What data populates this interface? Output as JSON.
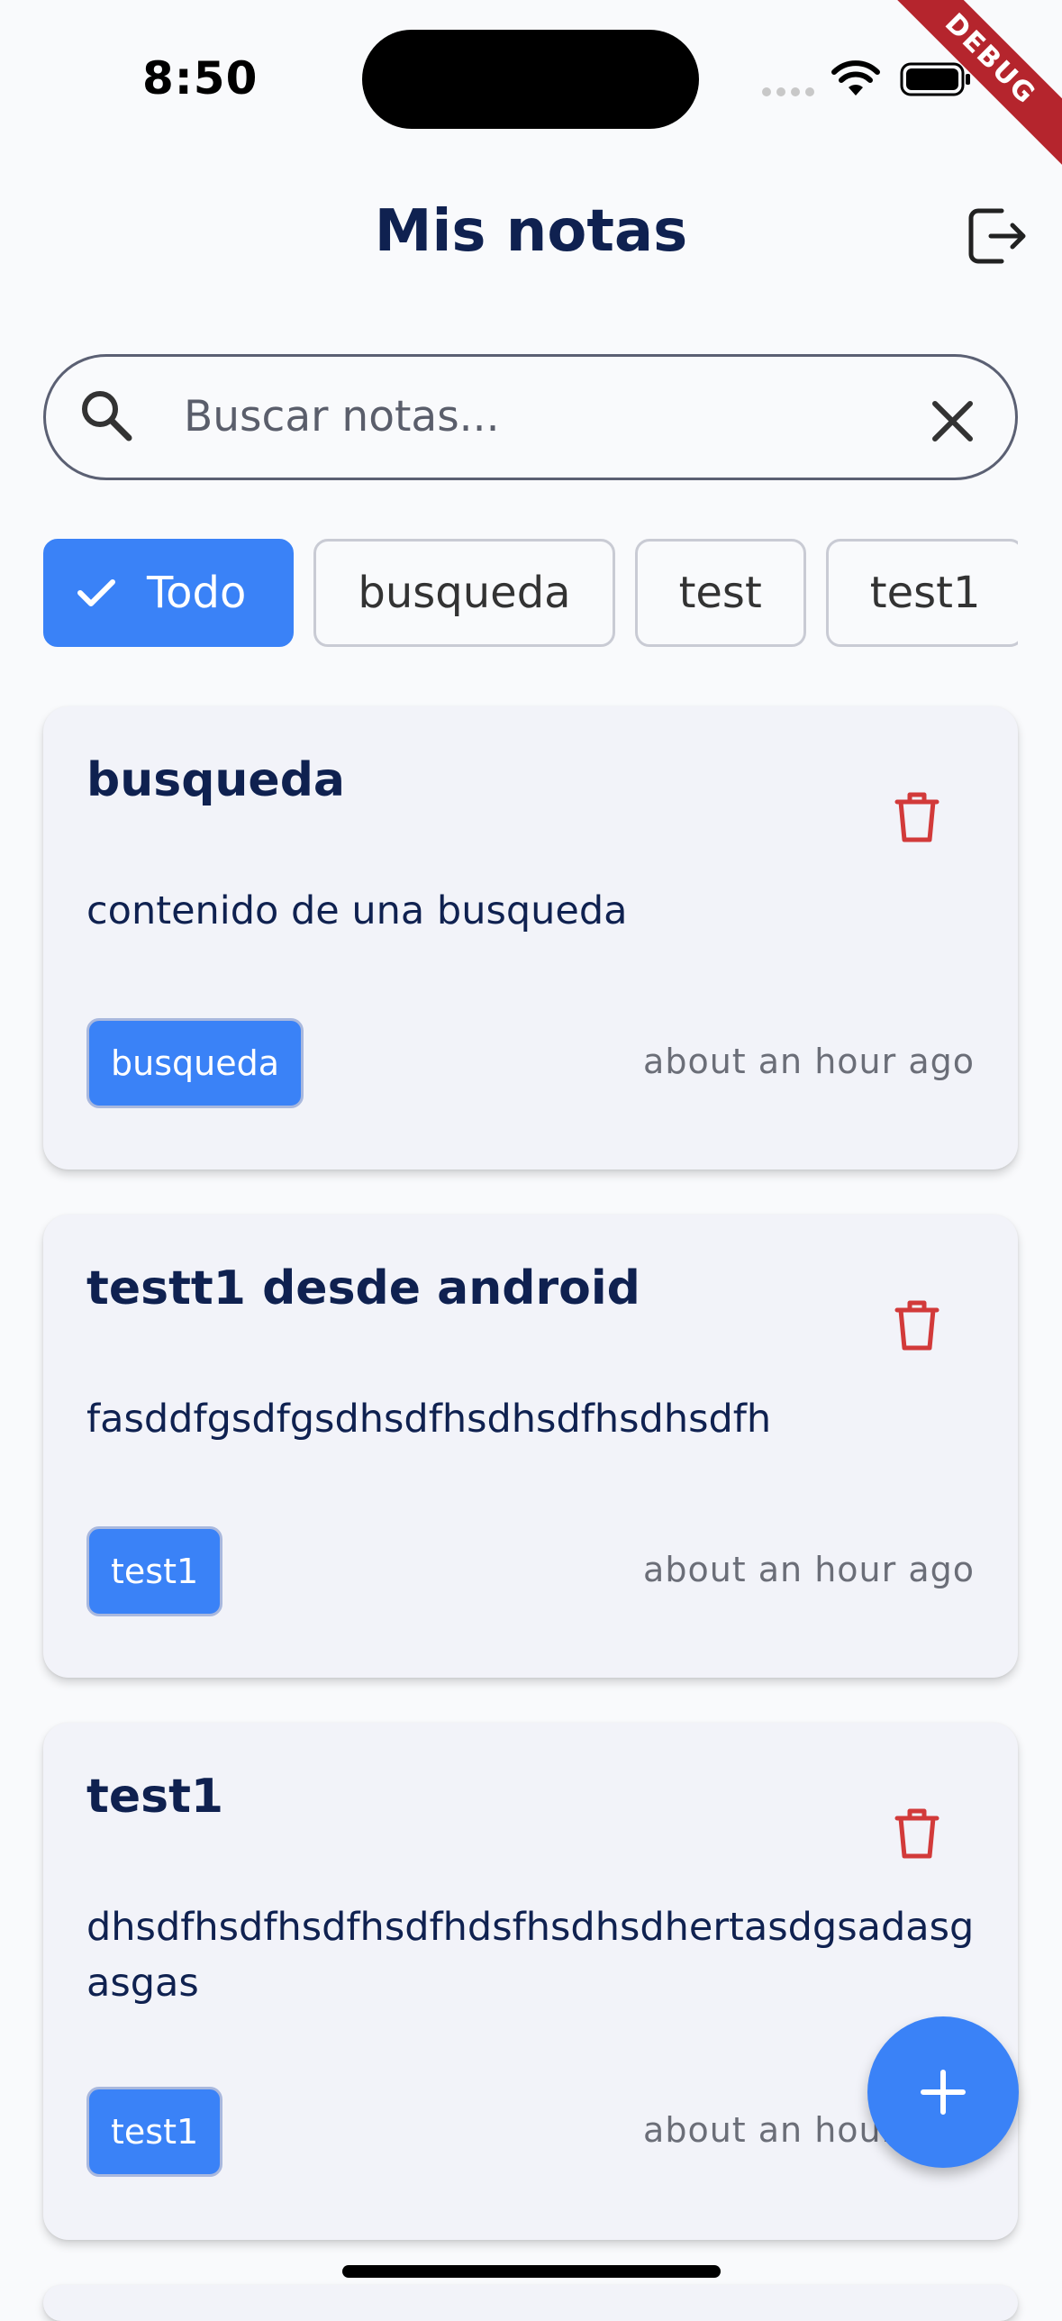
{
  "status_bar": {
    "time": "8:50",
    "debug_label": "DEBUG"
  },
  "header": {
    "title": "Mis notas",
    "logout_icon": "logout-icon"
  },
  "search": {
    "placeholder": "Buscar notas...",
    "value": ""
  },
  "filters": [
    {
      "label": "Todo",
      "selected": true
    },
    {
      "label": "busqueda",
      "selected": false
    },
    {
      "label": "test",
      "selected": false
    },
    {
      "label": "test1",
      "selected": false
    }
  ],
  "notes": [
    {
      "title": "busqueda",
      "content": "contenido de una busqueda",
      "tag": "busqueda",
      "time": "about an hour ago"
    },
    {
      "title": "testt1 desde android",
      "content": "fasddfgsdfgsdhsdfhsdhsdfhsdhsdfh",
      "tag": "test1",
      "time": "about an hour ago"
    },
    {
      "title": "test1",
      "content": "dhsdfhsdfhsdfhsdfhdsfhsdhsdhertasdgsadasgasgas",
      "tag": "test1",
      "time": "about an hour ago"
    }
  ],
  "colors": {
    "accent": "#3a82f7",
    "title": "#0f2150",
    "delete": "#d23a3a"
  }
}
